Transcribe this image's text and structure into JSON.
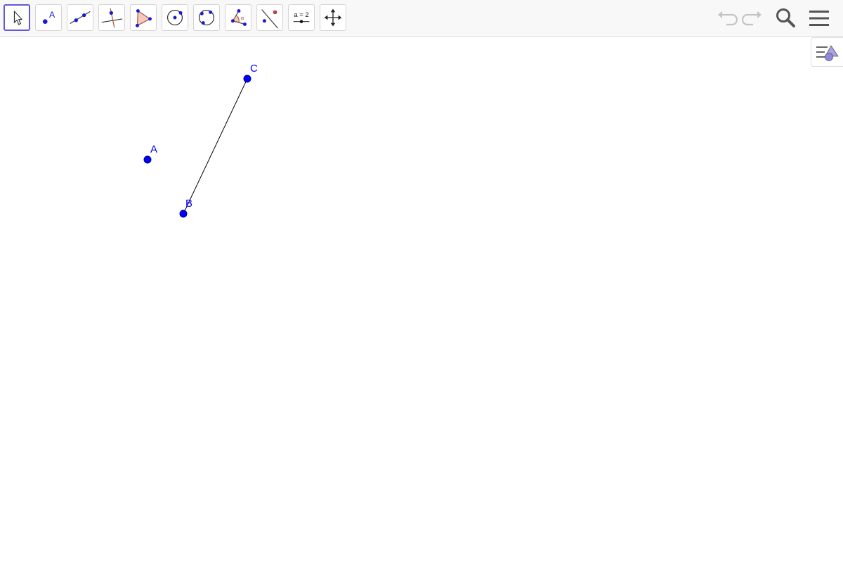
{
  "toolbar": {
    "tools": [
      {
        "name": "move-tool",
        "icon": "arrow-cursor-icon"
      },
      {
        "name": "point-tool",
        "icon": "point-icon",
        "label": "A"
      },
      {
        "name": "line-tool",
        "icon": "line-through-points-icon"
      },
      {
        "name": "perpendicular-line-tool",
        "icon": "perpendicular-line-icon"
      },
      {
        "name": "polygon-tool",
        "icon": "polygon-icon"
      },
      {
        "name": "circle-tool",
        "icon": "circle-center-point-icon"
      },
      {
        "name": "circle-three-points-tool",
        "icon": "circle-three-points-icon"
      },
      {
        "name": "angle-tool",
        "icon": "angle-icon",
        "label": "α"
      },
      {
        "name": "reflect-tool",
        "icon": "reflect-about-line-icon"
      },
      {
        "name": "slider-tool",
        "icon": "slider-icon",
        "label": "a = 2"
      },
      {
        "name": "move-graphics-view-tool",
        "icon": "move-arrows-icon"
      }
    ],
    "active_tool": "move-tool",
    "right": {
      "undo_icon": "undo-icon",
      "redo_icon": "redo-icon",
      "search_icon": "search-icon",
      "menu_icon": "hamburger-menu-icon"
    }
  },
  "style_bar_toggle": {
    "icon": "style-bar-toggle-icon"
  },
  "graphics": {
    "points": [
      {
        "label": "A"
      },
      {
        "label": "B"
      },
      {
        "label": "C"
      }
    ],
    "segments": [
      {
        "from": "B",
        "to": "C"
      }
    ]
  },
  "colors": {
    "point": "#0000ff",
    "point_outline": "#000080",
    "segment": "#000000",
    "active_tool_border": "#6557d2",
    "toolbar_bg": "#f8f8f8"
  }
}
